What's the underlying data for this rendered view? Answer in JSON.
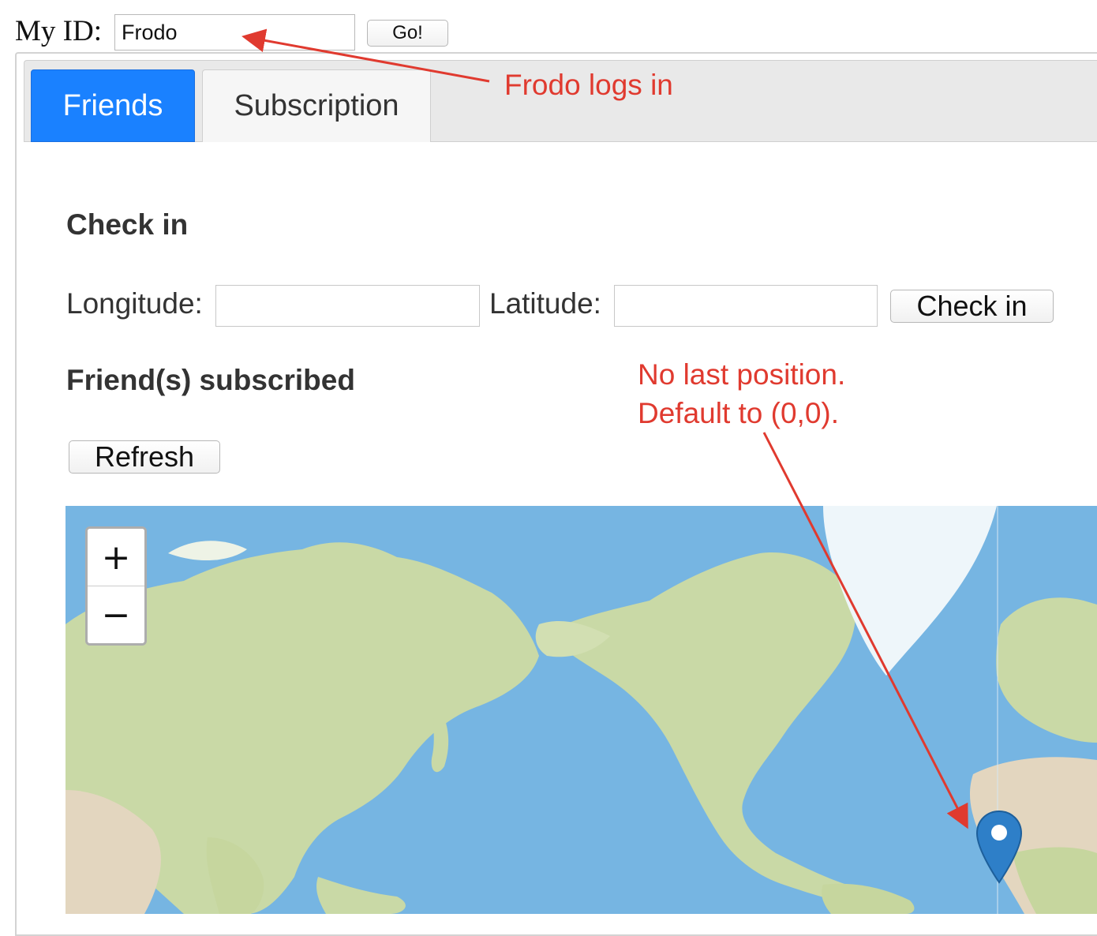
{
  "id_bar": {
    "label": "My ID:",
    "input_value": "Frodo",
    "go_label": "Go!"
  },
  "tabs": [
    {
      "label": "Friends",
      "active": true
    },
    {
      "label": "Subscription",
      "active": false
    }
  ],
  "checkin": {
    "heading": "Check in",
    "longitude_label": "Longitude:",
    "longitude_value": "",
    "latitude_label": "Latitude:",
    "latitude_value": "",
    "button_label": "Check in"
  },
  "friends": {
    "heading": "Friend(s) subscribed",
    "refresh_label": "Refresh"
  },
  "map": {
    "zoom_in_label": "+",
    "zoom_out_label": "−",
    "ocean_color": "#76b5e2",
    "land_color": "#c9d9a6",
    "marker_color": "#2e7fc8",
    "marker_icon": "map-pin-icon"
  },
  "annotations": {
    "login_note": "Frodo logs in",
    "default_note_line1": "No last position.",
    "default_note_line2": "Default to (0,0).",
    "color": "#e03a2f"
  }
}
